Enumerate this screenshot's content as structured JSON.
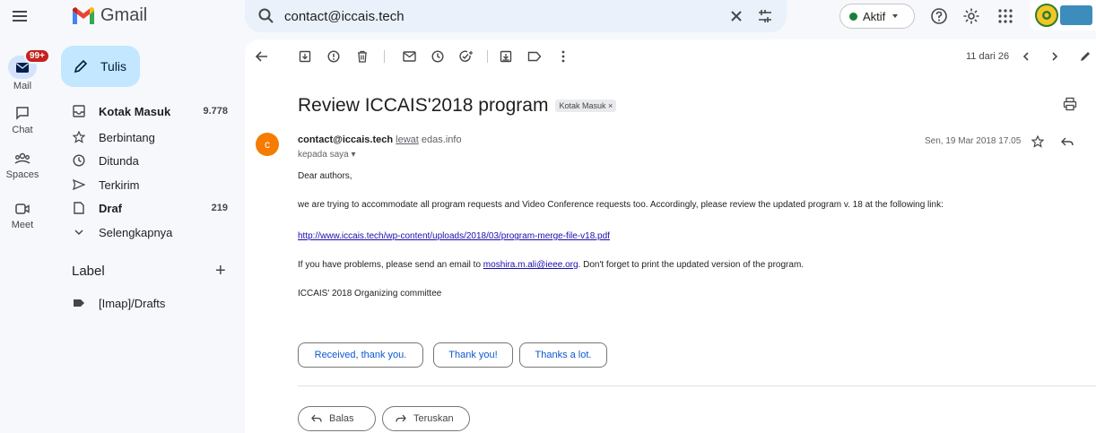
{
  "brand": {
    "name": "Gmail"
  },
  "search": {
    "value": "contact@iccais.tech"
  },
  "status": {
    "label": "Aktif"
  },
  "rail": [
    {
      "label": "Mail",
      "badge": "99+"
    },
    {
      "label": "Chat"
    },
    {
      "label": "Spaces"
    },
    {
      "label": "Meet"
    }
  ],
  "compose": {
    "label": "Tulis"
  },
  "nav": [
    {
      "label": "Kotak Masuk",
      "count": "9.778"
    },
    {
      "label": "Berbintang",
      "count": ""
    },
    {
      "label": "Ditunda",
      "count": ""
    },
    {
      "label": "Terkirim",
      "count": ""
    },
    {
      "label": "Draf",
      "count": "219"
    },
    {
      "label": "Selengkapnya",
      "count": ""
    }
  ],
  "labels": {
    "header": "Label",
    "items": [
      {
        "label": "[Imap]/Drafts"
      }
    ]
  },
  "pager": {
    "text": "11 dari 26"
  },
  "message": {
    "subject": "Review ICCAIS'2018 program",
    "subject_label": "Kotak Masuk ×",
    "avatar_letter": "c",
    "sender": "contact@iccais.tech",
    "via_label": "lewat",
    "via_domain": "edas.info",
    "to": "kepada saya ▾",
    "date": "Sen, 19 Mar 2018 17.05",
    "greeting": "Dear authors,",
    "para1": "we are trying to accommodate all program requests and Video Conference requests too. Accordingly, please review the updated program v. 18 at the following link:",
    "link": "http://www.iccais.tech/wp-content/uploads/2018/03/program-merge-file-v18.pdf",
    "para2_before": "If you have problems, please send an email to",
    "email_link": "moshira.m.ali@ieee.org",
    "para2_after": ". Don't forget to print the updated version of the program.",
    "signature": "ICCAIS' 2018 Organizing committee"
  },
  "smart_replies": [
    "Received, thank you.",
    "Thank you!",
    "Thanks a lot."
  ],
  "actions": {
    "reply": "Balas",
    "forward": "Teruskan"
  },
  "colors": {
    "accent": "#0b57d0",
    "compose_bg": "#c2e7ff",
    "badge": "#c5221f",
    "avatar": "#f57c00"
  }
}
